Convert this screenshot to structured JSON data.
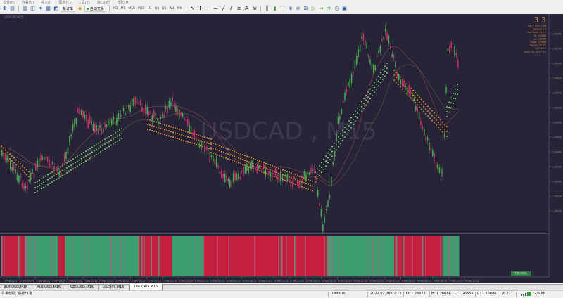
{
  "menu": [
    "文件(F)",
    "查看(V)",
    "插入(I)",
    "图表(C)",
    "工具(T)",
    "窗口(W)",
    "帮助(H)"
  ],
  "toolbar": {
    "new_order_label": "新订单",
    "autotrade_label": "自动交易",
    "timeframes": [
      "M1",
      "M5",
      "M15",
      "M30",
      "H1",
      "H4",
      "D1",
      "W1",
      "MN"
    ]
  },
  "chart": {
    "symbol_label": "USDCAD,M15",
    "watermark": "USDCAD , M15",
    "price_ticks": [
      "1.26800",
      "1.26750",
      "1.26700",
      "1.26650",
      "1.26600",
      "1.26550",
      "1.26500",
      "1.26450",
      "1.26400",
      "1.26350",
      "1.26300",
      "1.26250",
      "1.26200"
    ],
    "time_ticks": [
      "7 Feb 2022",
      "7 Feb 04:15",
      "7 Feb 06:15",
      "7 Feb 08:15",
      "7 Feb 10:15",
      "7 Feb 12:15",
      "7 Feb 14:15",
      "7 Feb 16:15",
      "7 Feb 18:15",
      "7 Feb 20:15",
      "7 Feb 22:15",
      "8 Feb 00:15",
      "8 Feb 02:15",
      "8 Feb 04:15",
      "8 Feb 06:15",
      "8 Feb 08:15",
      "8 Feb 10:15",
      "8 Feb 12:15",
      "8 Feb 14:15",
      "8 Feb 16:15",
      "8 Feb 18:15",
      "8 Feb 20:15",
      "8 Feb 22:15",
      "9 Feb 00:15",
      "9 Feb 02:15",
      "9 Feb 04:15",
      "9 Feb 06:15",
      "9 Feb 08:15",
      "9 Feb 10:15",
      "9 Feb 12:15"
    ],
    "info_big": "3.3",
    "info_lines": [
      "Bar 1 VOL: 4.09",
      "Spread: 3.4",
      "Bar Time: 01:15",
      "Hi: 1.2686",
      "Lo: 1.2665",
      "Close: 1.2668",
      "Range: 21 pts",
      "ATR: 17.1",
      "Swap L/S: -0.8 / 0.2"
    ],
    "indicator_label": "T.W.HMA",
    "colors": {
      "bg": "#272437",
      "bull": "#4aa84e",
      "bear": "#c0316a",
      "hist_green": "#3a9e6e",
      "hist_red": "#c5203f",
      "dots_orange": "#ff9f2a",
      "dots_green": "#8cf07a",
      "axis_text": "#9a8f7e",
      "info_text": "#c98a3a"
    }
  },
  "tabs": [
    "EURUSD,M15",
    "AUDUSD,M15",
    "NZDUSD,M15",
    "USDJPY,M15",
    "USDCAD,M15"
  ],
  "active_tab": 4,
  "status": {
    "help": "寻求帮助, 请按F1键",
    "profile": "Default",
    "datetime": "2022.02.08 01:15",
    "open": "O: 1.26677",
    "high": "H: 1.26686",
    "low": "L: 1.26655",
    "close": "C: 1.26686",
    "volume": "V: 217",
    "traffic": "72/5 kb"
  }
}
